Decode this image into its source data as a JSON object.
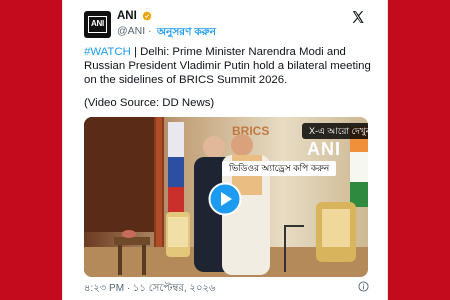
{
  "tweet": {
    "author_name": "ANI",
    "handle": "@ANI",
    "separator": "·",
    "follow_label": "অনুসরণ করুন",
    "hashtag": "#WATCH",
    "body_text": " | Delhi: Prime Minister Narendra Modi and Russian President Vladimir Putin hold a bilateral meeting on the sidelines of BRICS Summit 2026.",
    "source_text": "(Video Source: DD News)",
    "timestamp": "৪:২৩ PM · ১১ সেপ্টেম্বর, ২০২৬"
  },
  "video": {
    "watch_on_x_label": "X-এ আরো দেখুন",
    "copy_address_label": "ভিডিওর অ্যাড্রেস কপি করুন",
    "watermark": "ANI",
    "backdrop_text": "BRICS"
  },
  "colors": {
    "page_bg": "#c40b1e",
    "accent": "#1d9bf0",
    "text": "#0f1419",
    "muted": "#536471"
  },
  "icons": {
    "verified": "verified-badge-icon",
    "x_logo": "x-logo-icon",
    "play": "play-icon",
    "info": "info-icon"
  }
}
